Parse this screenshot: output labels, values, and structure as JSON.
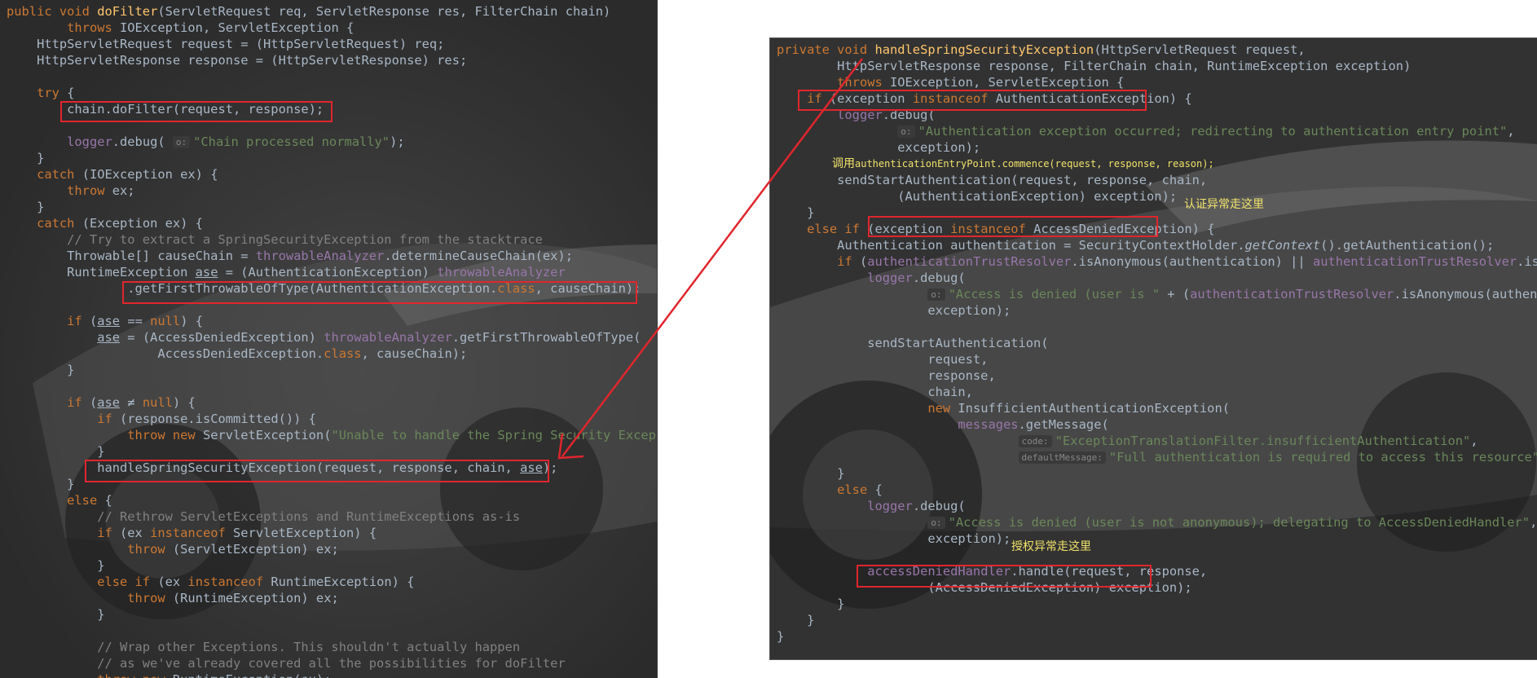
{
  "left_code": {
    "lines": [
      [
        [
          "kw",
          "public void "
        ],
        [
          "fn",
          "doFilter"
        ],
        [
          "p",
          "(ServletRequest req, ServletResponse res, FilterChain chain)"
        ]
      ],
      [
        [
          "p",
          "        "
        ],
        [
          "kw",
          "throws "
        ],
        [
          "p",
          "IOException, ServletException {"
        ]
      ],
      [
        [
          "p",
          "    HttpServletRequest request = (HttpServletRequest) req;"
        ]
      ],
      [
        [
          "p",
          "    HttpServletResponse response = (HttpServletResponse) res;"
        ]
      ],
      [
        [
          "p",
          ""
        ]
      ],
      [
        [
          "p",
          "    "
        ],
        [
          "kw",
          "try "
        ],
        [
          "p",
          "{"
        ]
      ],
      [
        [
          "p",
          "        chain.doFilter(request, response);"
        ]
      ],
      [
        [
          "p",
          ""
        ]
      ],
      [
        [
          "p",
          "        "
        ],
        [
          "fld",
          "logger"
        ],
        [
          "p",
          ".debug( "
        ],
        [
          "hint",
          "o:"
        ],
        [
          "str",
          "\"Chain processed normally\""
        ],
        [
          "p",
          ");"
        ]
      ],
      [
        [
          "p",
          "    }"
        ]
      ],
      [
        [
          "p",
          "    "
        ],
        [
          "kw",
          "catch "
        ],
        [
          "p",
          "(IOException ex) {"
        ]
      ],
      [
        [
          "p",
          "        "
        ],
        [
          "kw",
          "throw "
        ],
        [
          "p",
          "ex;"
        ]
      ],
      [
        [
          "p",
          "    }"
        ]
      ],
      [
        [
          "p",
          "    "
        ],
        [
          "kw",
          "catch "
        ],
        [
          "p",
          "(Exception ex) {"
        ]
      ],
      [
        [
          "cmt",
          "        // Try to extract a SpringSecurityException from the stacktrace"
        ]
      ],
      [
        [
          "p",
          "        Throwable[] causeChain = "
        ],
        [
          "fld",
          "throwableAnalyzer"
        ],
        [
          "p",
          ".determineCauseChain(ex);"
        ]
      ],
      [
        [
          "p",
          "        RuntimeException "
        ],
        [
          "ul",
          "ase"
        ],
        [
          "p",
          " = (AuthenticationException) "
        ],
        [
          "fld",
          "throwableAnalyzer"
        ]
      ],
      [
        [
          "p",
          "                .getFirstThrowableOfType(AuthenticationException."
        ],
        [
          "kw",
          "class"
        ],
        [
          "p",
          ", causeChain);"
        ]
      ],
      [
        [
          "p",
          ""
        ]
      ],
      [
        [
          "p",
          "        "
        ],
        [
          "kw",
          "if "
        ],
        [
          "p",
          "("
        ],
        [
          "ul",
          "ase"
        ],
        [
          "p",
          " == "
        ],
        [
          "kw",
          "null"
        ],
        [
          "p",
          ") {"
        ]
      ],
      [
        [
          "p",
          "            "
        ],
        [
          "ul",
          "ase"
        ],
        [
          "p",
          " = (AccessDeniedException) "
        ],
        [
          "fld",
          "throwableAnalyzer"
        ],
        [
          "p",
          ".getFirstThrowableOfType("
        ]
      ],
      [
        [
          "p",
          "                    AccessDeniedException."
        ],
        [
          "kw",
          "class"
        ],
        [
          "p",
          ", causeChain);"
        ]
      ],
      [
        [
          "p",
          "        }"
        ]
      ],
      [
        [
          "p",
          ""
        ]
      ],
      [
        [
          "p",
          "        "
        ],
        [
          "kw",
          "if "
        ],
        [
          "p",
          "("
        ],
        [
          "ul",
          "ase"
        ],
        [
          "p",
          " ≠ "
        ],
        [
          "kw",
          "null"
        ],
        [
          "p",
          ") {"
        ]
      ],
      [
        [
          "p",
          "            "
        ],
        [
          "kw",
          "if "
        ],
        [
          "p",
          "(response.isCommitted()) {"
        ]
      ],
      [
        [
          "p",
          "                "
        ],
        [
          "kw",
          "throw new "
        ],
        [
          "p",
          "ServletException("
        ],
        [
          "str",
          "\"Unable to handle the Spring Security Exceptio"
        ]
      ],
      [
        [
          "p",
          "            }"
        ]
      ],
      [
        [
          "p",
          "            handleSpringSecurityException(request, response, chain, "
        ],
        [
          "ul",
          "ase"
        ],
        [
          "p",
          ");"
        ]
      ],
      [
        [
          "p",
          "        }"
        ]
      ],
      [
        [
          "p",
          "        "
        ],
        [
          "kw",
          "else "
        ],
        [
          "p",
          "{"
        ]
      ],
      [
        [
          "cmt",
          "            // Rethrow ServletExceptions and RuntimeExceptions as-is"
        ]
      ],
      [
        [
          "p",
          "            "
        ],
        [
          "kw",
          "if "
        ],
        [
          "p",
          "(ex "
        ],
        [
          "kw",
          "instanceof "
        ],
        [
          "p",
          "ServletException) {"
        ]
      ],
      [
        [
          "p",
          "                "
        ],
        [
          "kw",
          "throw "
        ],
        [
          "p",
          "(ServletException) ex;"
        ]
      ],
      [
        [
          "p",
          "            }"
        ]
      ],
      [
        [
          "p",
          "            "
        ],
        [
          "kw",
          "else if "
        ],
        [
          "p",
          "(ex "
        ],
        [
          "kw",
          "instanceof "
        ],
        [
          "p",
          "RuntimeException) {"
        ]
      ],
      [
        [
          "p",
          "                "
        ],
        [
          "kw",
          "throw "
        ],
        [
          "p",
          "(RuntimeException) ex;"
        ]
      ],
      [
        [
          "p",
          "            }"
        ]
      ],
      [
        [
          "p",
          ""
        ]
      ],
      [
        [
          "cmt",
          "            // Wrap other Exceptions. This shouldn't actually happen"
        ]
      ],
      [
        [
          "cmt",
          "            // as we've already covered all the possibilities for doFilter"
        ]
      ],
      [
        [
          "p",
          "            "
        ],
        [
          "kw",
          "throw new "
        ],
        [
          "p",
          "RuntimeException(ex);"
        ]
      ]
    ]
  },
  "right_code": {
    "lines": [
      [
        [
          "kw",
          "private void "
        ],
        [
          "fn",
          "handleSpringSecurityException"
        ],
        [
          "p",
          "(HttpServletRequest request,"
        ]
      ],
      [
        [
          "p",
          "        HttpServletResponse response, FilterChain chain, RuntimeException exception)"
        ]
      ],
      [
        [
          "p",
          "        "
        ],
        [
          "kw",
          "throws "
        ],
        [
          "p",
          "IOException, ServletException {"
        ]
      ],
      [
        [
          "p",
          "    "
        ],
        [
          "kw",
          "if "
        ],
        [
          "p",
          "(exception "
        ],
        [
          "kw",
          "instanceof "
        ],
        [
          "p",
          "AuthenticationException) {"
        ]
      ],
      [
        [
          "p",
          "        "
        ],
        [
          "fld",
          "logger"
        ],
        [
          "p",
          ".debug("
        ]
      ],
      [
        [
          "p",
          "                "
        ],
        [
          "hint",
          "o:"
        ],
        [
          "str",
          "\"Authentication exception occurred; redirecting to authentication entry point\""
        ],
        [
          "p",
          ","
        ]
      ],
      [
        [
          "p",
          "                exception);"
        ]
      ],
      [
        [
          "p",
          ""
        ]
      ],
      [
        [
          "p",
          "        sendStartAuthentication(request, response, chain,"
        ]
      ],
      [
        [
          "p",
          "                (AuthenticationException) exception);"
        ]
      ],
      [
        [
          "p",
          "    }"
        ]
      ],
      [
        [
          "p",
          "    "
        ],
        [
          "kw",
          "else if "
        ],
        [
          "p",
          "(exception "
        ],
        [
          "kw",
          "instanceof "
        ],
        [
          "p",
          "AccessDeniedException) {"
        ]
      ],
      [
        [
          "p",
          "        Authentication authentication = SecurityContextHolder."
        ],
        [
          "it",
          "getContext"
        ],
        [
          "p",
          "().getAuthentication();"
        ]
      ],
      [
        [
          "p",
          "        "
        ],
        [
          "kw",
          "if "
        ],
        [
          "p",
          "("
        ],
        [
          "fld",
          "authenticationTrustResolver"
        ],
        [
          "p",
          ".isAnonymous(authentication) || "
        ],
        [
          "fld",
          "authenticationTrustResolver"
        ],
        [
          "p",
          ".isRem"
        ]
      ],
      [
        [
          "p",
          "            "
        ],
        [
          "fld",
          "logger"
        ],
        [
          "p",
          ".debug("
        ]
      ],
      [
        [
          "p",
          "                    "
        ],
        [
          "hint",
          "o:"
        ],
        [
          "str",
          "\"Access is denied (user is \""
        ],
        [
          "p",
          " + ("
        ],
        [
          "fld",
          "authenticationTrustResolver"
        ],
        [
          "p",
          ".isAnonymous(authenticati"
        ]
      ],
      [
        [
          "p",
          "                    exception);"
        ]
      ],
      [
        [
          "p",
          ""
        ]
      ],
      [
        [
          "p",
          "            sendStartAuthentication("
        ]
      ],
      [
        [
          "p",
          "                    request,"
        ]
      ],
      [
        [
          "p",
          "                    response,"
        ]
      ],
      [
        [
          "p",
          "                    chain,"
        ]
      ],
      [
        [
          "p",
          "                    "
        ],
        [
          "kw",
          "new "
        ],
        [
          "p",
          "InsufficientAuthenticationException("
        ]
      ],
      [
        [
          "p",
          "                        "
        ],
        [
          "fld",
          "messages"
        ],
        [
          "p",
          ".getMessage("
        ]
      ],
      [
        [
          "p",
          "                                "
        ],
        [
          "hint",
          "code:"
        ],
        [
          "str",
          "\"ExceptionTranslationFilter.insufficientAuthentication\""
        ],
        [
          "p",
          ","
        ]
      ],
      [
        [
          "p",
          "                                "
        ],
        [
          "hint",
          "defaultMessage:"
        ],
        [
          "str",
          "\"Full authentication is required to access this resource\""
        ],
        [
          "p",
          ")));"
        ]
      ],
      [
        [
          "p",
          "        }"
        ]
      ],
      [
        [
          "p",
          "        "
        ],
        [
          "kw",
          "else "
        ],
        [
          "p",
          "{"
        ]
      ],
      [
        [
          "p",
          "            "
        ],
        [
          "fld",
          "logger"
        ],
        [
          "p",
          ".debug("
        ]
      ],
      [
        [
          "p",
          "                    "
        ],
        [
          "hint",
          "o:"
        ],
        [
          "str",
          "\"Access is denied (user is not anonymous); delegating to AccessDeniedHandler\""
        ],
        [
          "p",
          ","
        ]
      ],
      [
        [
          "p",
          "                    exception);"
        ]
      ],
      [
        [
          "p",
          ""
        ]
      ],
      [
        [
          "p",
          "            "
        ],
        [
          "fld",
          "accessDeniedHandler"
        ],
        [
          "p",
          ".handle(request, response,"
        ]
      ],
      [
        [
          "p",
          "                    (AccessDeniedException) exception);"
        ]
      ],
      [
        [
          "p",
          "        }"
        ]
      ],
      [
        [
          "p",
          "    }"
        ]
      ],
      [
        [
          "p",
          "}"
        ]
      ]
    ]
  },
  "annotations": {
    "entry_point_prefix": "调用",
    "entry_point_code": "authenticationEntryPoint.commence(request, response, reason);",
    "auth_note": "认证异常走这里",
    "access_note": "授权异常走这里"
  },
  "colors": {
    "highlight_box": "#e0262d",
    "arrow": "#e0262d",
    "note_text": "#f1e26a",
    "editor_bg": "#2b2b2b"
  }
}
